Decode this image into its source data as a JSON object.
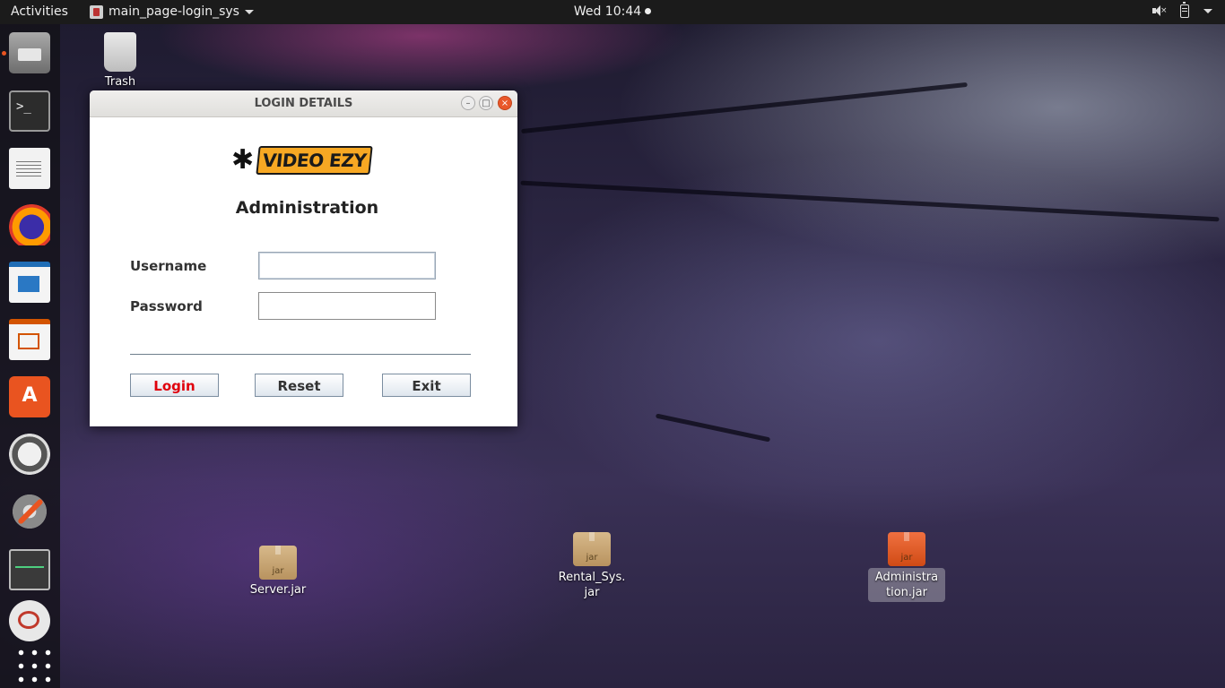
{
  "topbar": {
    "activities": "Activities",
    "app_name": "main_page-login_sys",
    "clock": "Wed 10:44"
  },
  "dock": {
    "items": [
      {
        "name": "files",
        "icon": "files-icon",
        "running": true
      },
      {
        "name": "terminal",
        "icon": "terminal-icon"
      },
      {
        "name": "text-editor",
        "icon": "text-editor-icon"
      },
      {
        "name": "firefox",
        "icon": "firefox-icon"
      },
      {
        "name": "libreoffice-writer",
        "icon": "writer-icon"
      },
      {
        "name": "libreoffice-impress",
        "icon": "impress-icon"
      },
      {
        "name": "software-center",
        "icon": "store-icon"
      },
      {
        "name": "software-updater",
        "icon": "updater-icon"
      },
      {
        "name": "system-settings",
        "icon": "settings-icon"
      },
      {
        "name": "system-monitor",
        "icon": "monitor-icon"
      },
      {
        "name": "java",
        "icon": "java-icon"
      },
      {
        "name": "show-applications",
        "icon": "app-grid-icon"
      }
    ]
  },
  "desktop": {
    "trash_label": "Trash",
    "files": [
      {
        "label": "Server.jar",
        "icon": "jar-icon"
      },
      {
        "label": "Rental_Sys.\njar",
        "icon": "jar-icon"
      },
      {
        "label": "Administra\ntion.jar",
        "icon": "jar-icon",
        "selected": true
      }
    ]
  },
  "window": {
    "title": "LOGIN DETAILS",
    "logo_text": "VIDEO EZY",
    "heading": "Administration",
    "username_label": "Username",
    "username_value": "",
    "password_label": "Password",
    "password_value": "",
    "buttons": {
      "login": "Login",
      "reset": "Reset",
      "exit": "Exit"
    }
  },
  "colors": {
    "accent": "#e95420",
    "login_text": "#e0000c",
    "topbar": "#1b1b1b"
  }
}
